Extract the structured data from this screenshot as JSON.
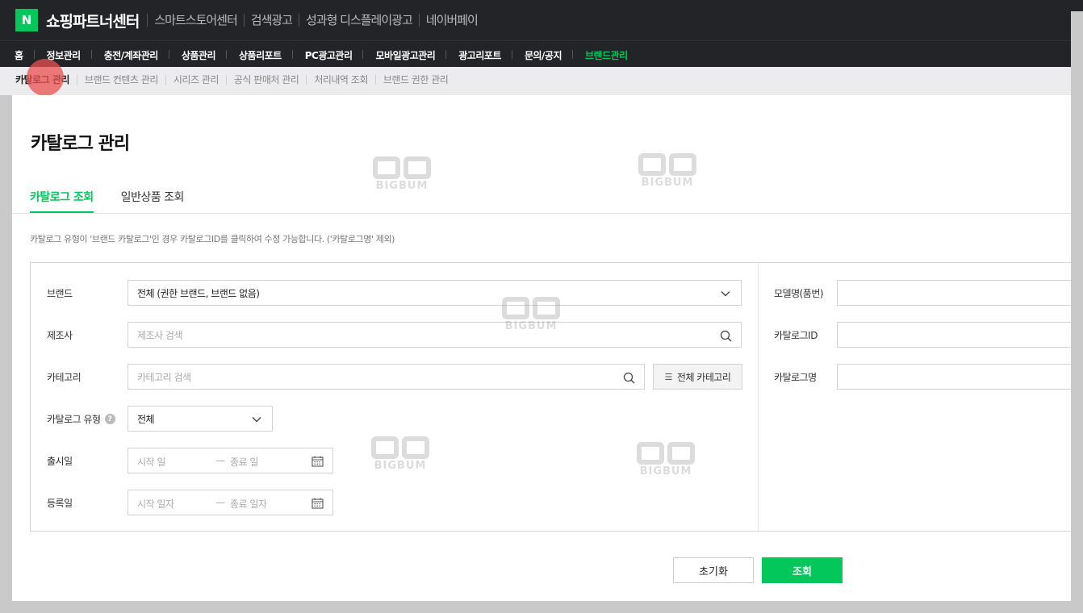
{
  "header": {
    "logo_letter": "N",
    "title": "쇼핑파트너센터",
    "links": [
      "스마트스토어센터",
      "검색광고",
      "성과형 디스플레이광고",
      "네이버페이"
    ]
  },
  "menu": {
    "items": [
      "홈",
      "정보관리",
      "충전/계좌관리",
      "상품관리",
      "상품리포트",
      "PC광고관리",
      "모바일광고관리",
      "광고리포트",
      "문의/공지",
      "브랜드관리"
    ],
    "active_index": 9,
    "active_color": "#03c75a"
  },
  "submenu": {
    "items": [
      "카탈로그 관리",
      "브랜드 컨텐츠 관리",
      "시리즈 관리",
      "공식 판매처 관리",
      "처리내역 조회",
      "브랜드 권한 관리"
    ]
  },
  "page": {
    "title": "카탈로그 관리",
    "tabs": [
      "카탈로그 조회",
      "일반상품 조회"
    ],
    "notice": "카탈로그 유형이 '브랜드 카탈로그'인 경우 카탈로그ID를 클릭하여 수정 가능합니다. ('카탈로그명' 제외)"
  },
  "filters": {
    "brand_label": "브랜드",
    "brand_value": "전체 (권한 브랜드, 브랜드 없음)",
    "maker_label": "제조사",
    "maker_placeholder": "제조사 검색",
    "category_label": "카테고리",
    "category_placeholder": "카테고리 검색",
    "all_category_button": "전체 카테고리",
    "catalog_type_label": "카탈로그 유형",
    "catalog_type_help": "?",
    "catalog_type_value": "전체",
    "release_label": "출시일",
    "release_start_placeholder": "시작 일",
    "release_end_placeholder": "종료 일",
    "register_label": "등록일",
    "register_start_placeholder": "시작 일자",
    "register_end_placeholder": "종료 일자",
    "date_sep": "—",
    "model_label": "모델명(품번)",
    "catalog_id_label": "카탈로그ID",
    "catalog_name_label": "카탈로그명"
  },
  "buttons": {
    "reset": "초기화",
    "search": "조회"
  },
  "watermark": {
    "text": "BIGBUM"
  }
}
